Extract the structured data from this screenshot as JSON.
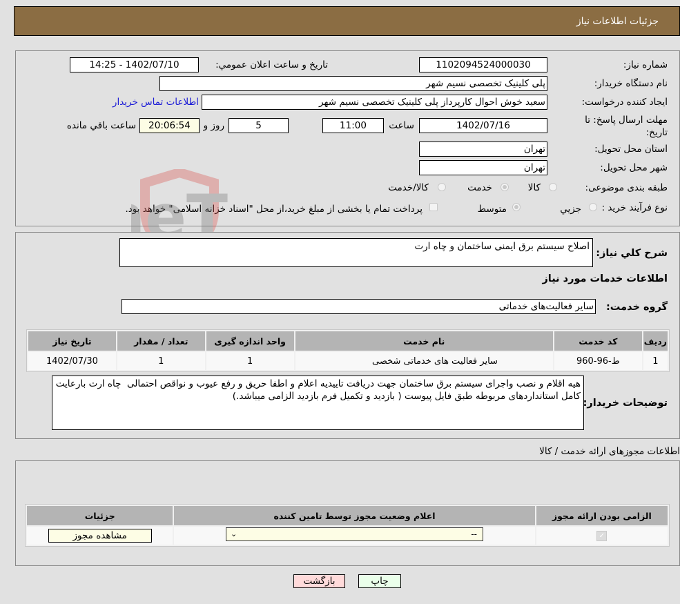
{
  "header": {
    "title": "جزئیات اطلاعات نیاز"
  },
  "form": {
    "need_number_label": "شماره نیاز:",
    "need_number": "1102094524000030",
    "announce_label": "تاريخ و ساعت اعلان عمومي:",
    "announce_value": "1402/07/10 - 14:25",
    "buyer_org_label": "نام دستگاه خريدار:",
    "buyer_org": "پلی کلینیک تخصصی نسیم شهر",
    "requester_label": "ايجاد کننده درخواست:",
    "requester": "سعید خوش احوال کارپرداز پلی کلینیک تخصصی نسیم شهر",
    "buyer_contact_link": "اطلاعات تماس خريدار",
    "deadline_label": "مهلت ارسال پاسخ: تا تاريخ:",
    "deadline_date": "1402/07/16",
    "time_label": "ساعت",
    "deadline_time": "11:00",
    "days_value": "5",
    "days_label": "روز و",
    "remaining_time": "20:06:54",
    "remaining_label": "ساعت باقي مانده",
    "province_label": "استان محل تحويل:",
    "province": "تهران",
    "city_label": "شهر محل تحويل:",
    "city": "تهران",
    "category_label": "طبقه بندی موضوعی:",
    "category_options": [
      {
        "label": "کالا",
        "selected": false
      },
      {
        "label": "خدمت",
        "selected": true
      },
      {
        "label": "کالا/خدمت",
        "selected": false
      }
    ],
    "process_label": "نوع فرآيند خريد :",
    "process_options": [
      {
        "label": "جزيي",
        "selected": false
      },
      {
        "label": "متوسط",
        "selected": true
      }
    ],
    "treasury_note": "پرداخت تمام يا بخشی از مبلغ خريد،از محل \"اسناد خزانه اسلامی\" خواهد بود."
  },
  "summary": {
    "desc_label": "شرح کلي نياز:",
    "desc_value": "اصلاح سیستم برق ایمنی ساختمان و چاه ارت",
    "services_title": "اطلاعات خدمات مورد نياز",
    "group_label": "گروه خدمت:",
    "group_value": "ساير فعاليت‌هاى خدماتى"
  },
  "services_table": {
    "headers": [
      "رديف",
      "کد خدمت",
      "نام خدمت",
      "واحد اندازه گيری",
      "تعداد / مقدار",
      "تاريخ نياز"
    ],
    "rows": [
      [
        "1",
        "ط-96-960",
        "سایر فعالیت های خدماتی شخصی",
        "1",
        "1",
        "1402/07/30"
      ]
    ]
  },
  "buyer_notes": {
    "label": "توضيحات خريدار:",
    "value": "هیه اقلام و نصب واجرای سیستم برق ساختمان جهت دریافت تاییدیه اعلام و اطفا حریق و رفع عیوب و نواقص احتمالی  چاه ارت بارعایت کامل استانداردهای مربوطه طبق فایل پیوست ( بازدید و تکمیل فرم بازدید الزامی میباشد.)"
  },
  "permits": {
    "section_title": "اطلاعات مجوزهای ارائه خدمت / کالا",
    "headers": [
      "الزامی بودن ارائه مجوز",
      "اعلام وضعيت مجوز توسط تامين کننده",
      "جزئيات"
    ],
    "row": {
      "required_checked": true,
      "status_value": "--",
      "details_button": "مشاهده مجوز"
    }
  },
  "buttons": {
    "print": "چاپ",
    "back": "بازگشت"
  },
  "watermark": {
    "text": "AriaTender.neT"
  }
}
